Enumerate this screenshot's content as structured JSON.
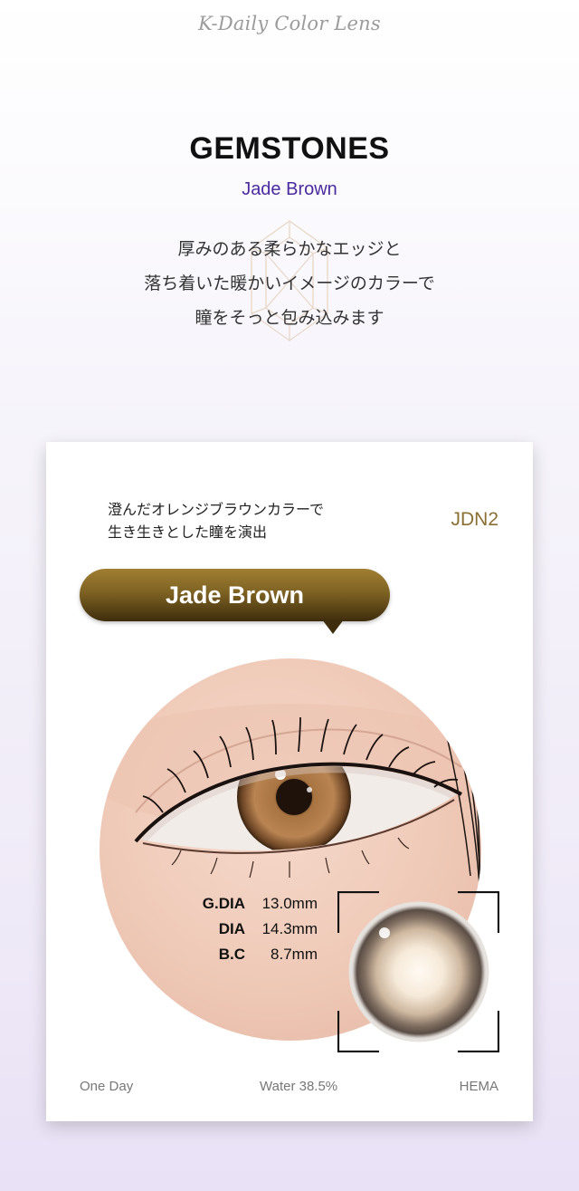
{
  "brand": "K-Daily Color Lens",
  "product": {
    "collection": "GEMSTONES",
    "name": "Jade Brown",
    "description": [
      "厚みのある柔らかなエッジと",
      "落ち着いた暖かいイメージのカラーで",
      "瞳をそっと包み込みます"
    ]
  },
  "card": {
    "description": [
      "澄んだオレンジブラウンカラーで",
      "生き生きとした瞳を演出"
    ],
    "code": "JDN2",
    "pill_label": "Jade Brown",
    "specs": [
      {
        "label": "G.DIA",
        "value": "13.0mm"
      },
      {
        "label": "DIA",
        "value": "14.3mm"
      },
      {
        "label": "B.C",
        "value": "8.7mm"
      }
    ],
    "footer": {
      "type": "One Day",
      "water": "Water 38.5%",
      "material": "HEMA"
    }
  },
  "colors": {
    "accent_purple": "#4b2aa0",
    "gold": "#8b7034",
    "pill_dark": "#3e2d0d"
  }
}
